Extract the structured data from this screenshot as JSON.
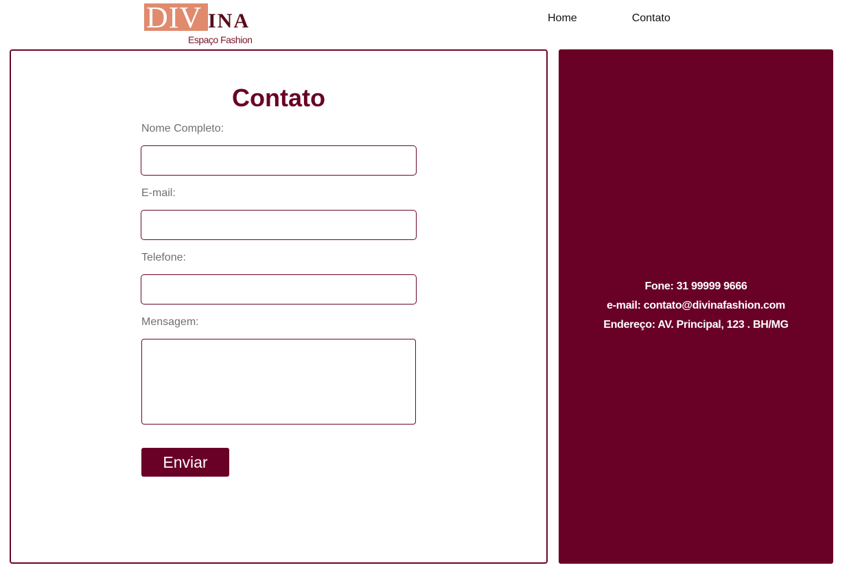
{
  "brand": {
    "logo_main": "DIV",
    "logo_suffix": "INA",
    "logo_tagline": "Espaço Fashion"
  },
  "nav": {
    "items": [
      {
        "label": "Home"
      },
      {
        "label": "Contato"
      }
    ]
  },
  "form": {
    "title": "Contato",
    "fields": {
      "name_label": "Nome Completo:",
      "name_value": "",
      "email_label": "E-mail:",
      "email_value": "",
      "phone_label": "Telefone:",
      "phone_value": "",
      "message_label": "Mensagem:",
      "message_value": ""
    },
    "submit_label": "Enviar"
  },
  "info": {
    "phone": "Fone: 31 99999 9666",
    "email": "e-mail: contato@divinafashion.com",
    "address": "Endereço: AV. Principal, 123 . BH/MG"
  },
  "colors": {
    "brand_primary": "#690026",
    "logo_accent": "#e08a6e"
  }
}
